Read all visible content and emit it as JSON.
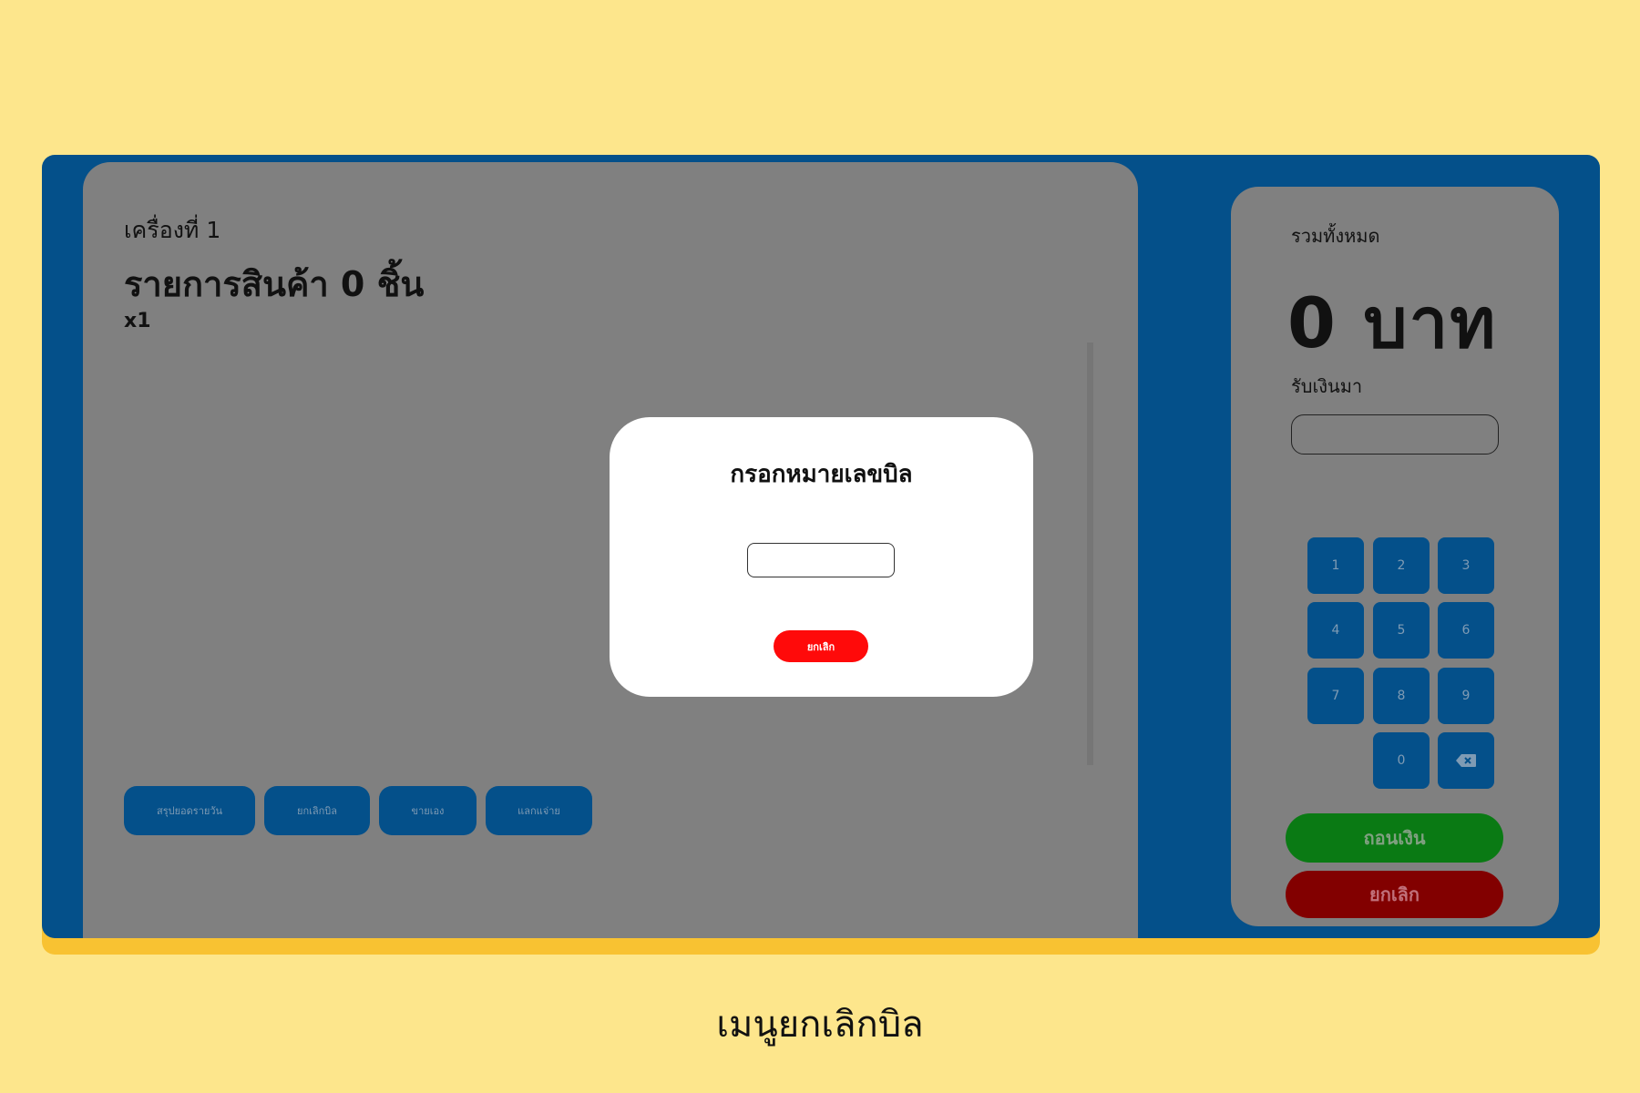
{
  "machine_label": "เครื่องที่ 1",
  "items_title": "รายการสินค้า 0 ชิ้น",
  "qty_label": "x1",
  "actions": [
    {
      "label": "สรุปยอดรายวัน"
    },
    {
      "label": "ยกเลิกบิล"
    },
    {
      "label": "ขายเอง"
    },
    {
      "label": "แลกแจ่าย"
    }
  ],
  "summary": {
    "total_label": "รวมทั้งหมด",
    "total_value": "0 บาท",
    "received_label": "รับเงินมา",
    "received_value": ""
  },
  "keypad": {
    "k1": "1",
    "k2": "2",
    "k3": "3",
    "k4": "4",
    "k5": "5",
    "k6": "6",
    "k7": "7",
    "k8": "8",
    "k9": "9",
    "k0": "0",
    "backspace_icon": "backspace-icon"
  },
  "buttons": {
    "withdraw": "ถอนเงิน",
    "cancel": "ยกเลิก"
  },
  "modal": {
    "title": "กรอกหมายเลขบิล",
    "input_value": "",
    "cancel": "ยกเลิก"
  },
  "caption": "เมนูยกเลิกบิล",
  "colors": {
    "background": "#fde68c",
    "frame": "#04508a",
    "panel": "#808080",
    "withdraw": "#0a7a14",
    "cancel": "#820000",
    "modal_cancel": "#ff0a0a"
  }
}
